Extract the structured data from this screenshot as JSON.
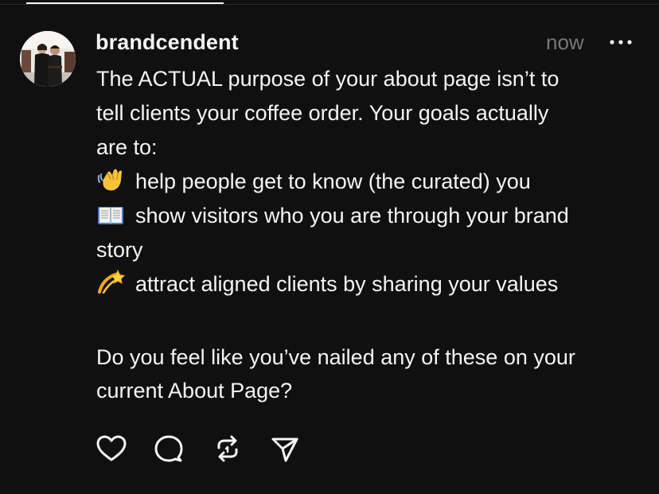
{
  "post": {
    "username": "brandcendent",
    "timestamp": "now",
    "intro_lines": [
      "The ACTUAL purpose of your about page isn’t to",
      "tell clients your coffee order. Your goals actually",
      "are to:"
    ],
    "list": [
      {
        "emoji": "waving-hand",
        "lines": [
          "help people get to know (the curated) you"
        ]
      },
      {
        "emoji": "open-book",
        "lines": [
          "show visitors who you are through your brand",
          "story"
        ]
      },
      {
        "emoji": "dizzy-star",
        "lines": [
          "attract aligned clients by sharing your values"
        ]
      }
    ],
    "question_lines": [
      "Do you feel like you’ve nailed any of these on your",
      "current About Page?"
    ]
  },
  "actions": {
    "like_icon": "heart-icon",
    "reply_icon": "comment-bubble-icon",
    "repost_icon": "repost-icon",
    "share_icon": "send-icon"
  },
  "colors": {
    "background": "#101010",
    "text": "#f3f5f7",
    "muted": "#777777",
    "divider": "#2a2a2a"
  }
}
